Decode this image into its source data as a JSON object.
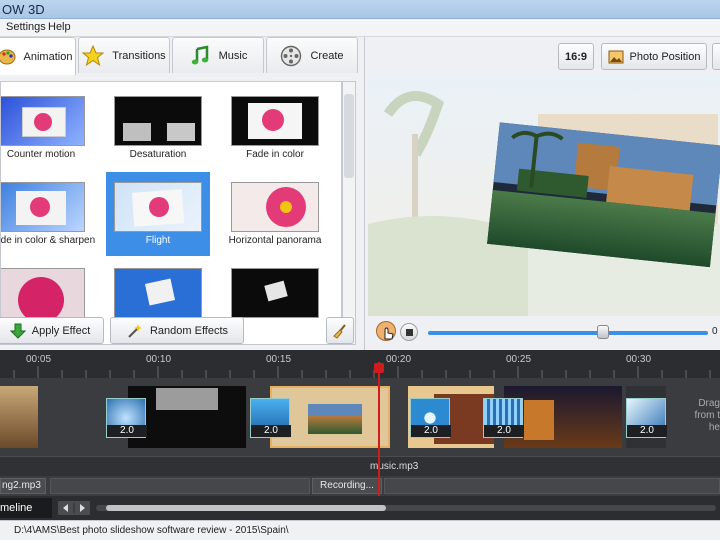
{
  "window": {
    "title": "OW 3D"
  },
  "menu": [
    "Settings",
    "Help"
  ],
  "tabs": [
    {
      "label": "Animation",
      "icon": "palette-icon"
    },
    {
      "label": "Transitions",
      "icon": "star-icon"
    },
    {
      "label": "Music",
      "icon": "music-note-icon"
    },
    {
      "label": "Create",
      "icon": "film-reel-icon"
    }
  ],
  "effects": [
    {
      "label": "Counter motion",
      "selected": false
    },
    {
      "label": "Desaturation",
      "selected": false
    },
    {
      "label": "Fade in color",
      "selected": false
    },
    {
      "label": "Fade in color & sharpen",
      "selected": false
    },
    {
      "label": "Flight",
      "selected": true
    },
    {
      "label": "Horizontal panorama",
      "selected": false
    },
    {
      "label": "",
      "selected": false
    },
    {
      "label": "",
      "selected": false
    },
    {
      "label": "",
      "selected": false
    }
  ],
  "buttons": {
    "apply_effect": "Apply Effect",
    "random_effects": "Random Effects",
    "aspect": "16:9",
    "photo_position": "Photo Position"
  },
  "player": {
    "progress": 0.72,
    "time_label": "0"
  },
  "timeline": {
    "ticks": [
      "00:05",
      "00:10",
      "00:15",
      "00:20",
      "00:25",
      "00:30"
    ],
    "transitions": [
      "2.0",
      "2.0",
      "2.0",
      "2.0",
      "2.0"
    ],
    "drag_hint_lines": [
      "Drag",
      "from t",
      "he"
    ],
    "music_track": "music.mp3",
    "track2_file": "ng2.mp3",
    "recording": "Recording...",
    "tab_label": "meline"
  },
  "status": {
    "path": "D:\\4\\AMS\\Best photo slideshow software review - 2015\\Spain\\"
  },
  "colors": {
    "accent": "#3d8ee6",
    "playhead": "#d01c1c",
    "timeline_bg": "#2b2d30"
  }
}
